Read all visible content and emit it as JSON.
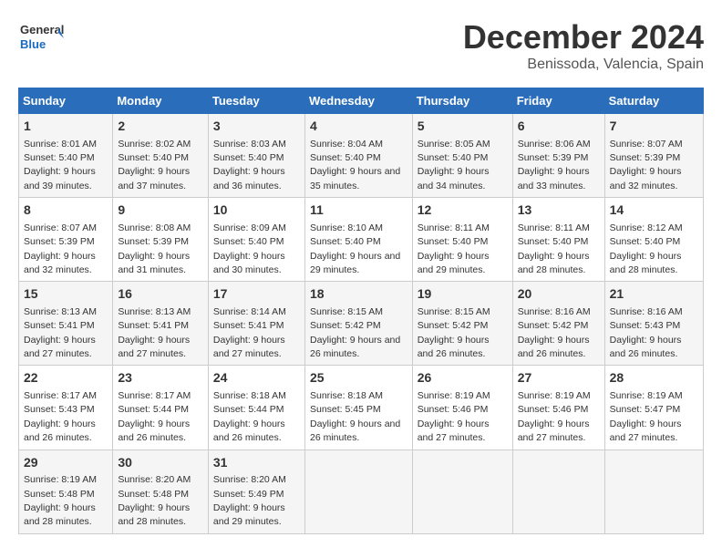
{
  "logo": {
    "line1": "General",
    "line2": "Blue"
  },
  "title": "December 2024",
  "subtitle": "Benissoda, Valencia, Spain",
  "days_of_week": [
    "Sunday",
    "Monday",
    "Tuesday",
    "Wednesday",
    "Thursday",
    "Friday",
    "Saturday"
  ],
  "weeks": [
    [
      {
        "day": "1",
        "sunrise": "8:01 AM",
        "sunset": "5:40 PM",
        "daylight": "9 hours and 39 minutes."
      },
      {
        "day": "2",
        "sunrise": "8:02 AM",
        "sunset": "5:40 PM",
        "daylight": "9 hours and 37 minutes."
      },
      {
        "day": "3",
        "sunrise": "8:03 AM",
        "sunset": "5:40 PM",
        "daylight": "9 hours and 36 minutes."
      },
      {
        "day": "4",
        "sunrise": "8:04 AM",
        "sunset": "5:40 PM",
        "daylight": "9 hours and 35 minutes."
      },
      {
        "day": "5",
        "sunrise": "8:05 AM",
        "sunset": "5:40 PM",
        "daylight": "9 hours and 34 minutes."
      },
      {
        "day": "6",
        "sunrise": "8:06 AM",
        "sunset": "5:39 PM",
        "daylight": "9 hours and 33 minutes."
      },
      {
        "day": "7",
        "sunrise": "8:07 AM",
        "sunset": "5:39 PM",
        "daylight": "9 hours and 32 minutes."
      }
    ],
    [
      {
        "day": "8",
        "sunrise": "8:07 AM",
        "sunset": "5:39 PM",
        "daylight": "9 hours and 32 minutes."
      },
      {
        "day": "9",
        "sunrise": "8:08 AM",
        "sunset": "5:39 PM",
        "daylight": "9 hours and 31 minutes."
      },
      {
        "day": "10",
        "sunrise": "8:09 AM",
        "sunset": "5:40 PM",
        "daylight": "9 hours and 30 minutes."
      },
      {
        "day": "11",
        "sunrise": "8:10 AM",
        "sunset": "5:40 PM",
        "daylight": "9 hours and 29 minutes."
      },
      {
        "day": "12",
        "sunrise": "8:11 AM",
        "sunset": "5:40 PM",
        "daylight": "9 hours and 29 minutes."
      },
      {
        "day": "13",
        "sunrise": "8:11 AM",
        "sunset": "5:40 PM",
        "daylight": "9 hours and 28 minutes."
      },
      {
        "day": "14",
        "sunrise": "8:12 AM",
        "sunset": "5:40 PM",
        "daylight": "9 hours and 28 minutes."
      }
    ],
    [
      {
        "day": "15",
        "sunrise": "8:13 AM",
        "sunset": "5:41 PM",
        "daylight": "9 hours and 27 minutes."
      },
      {
        "day": "16",
        "sunrise": "8:13 AM",
        "sunset": "5:41 PM",
        "daylight": "9 hours and 27 minutes."
      },
      {
        "day": "17",
        "sunrise": "8:14 AM",
        "sunset": "5:41 PM",
        "daylight": "9 hours and 27 minutes."
      },
      {
        "day": "18",
        "sunrise": "8:15 AM",
        "sunset": "5:42 PM",
        "daylight": "9 hours and 26 minutes."
      },
      {
        "day": "19",
        "sunrise": "8:15 AM",
        "sunset": "5:42 PM",
        "daylight": "9 hours and 26 minutes."
      },
      {
        "day": "20",
        "sunrise": "8:16 AM",
        "sunset": "5:42 PM",
        "daylight": "9 hours and 26 minutes."
      },
      {
        "day": "21",
        "sunrise": "8:16 AM",
        "sunset": "5:43 PM",
        "daylight": "9 hours and 26 minutes."
      }
    ],
    [
      {
        "day": "22",
        "sunrise": "8:17 AM",
        "sunset": "5:43 PM",
        "daylight": "9 hours and 26 minutes."
      },
      {
        "day": "23",
        "sunrise": "8:17 AM",
        "sunset": "5:44 PM",
        "daylight": "9 hours and 26 minutes."
      },
      {
        "day": "24",
        "sunrise": "8:18 AM",
        "sunset": "5:44 PM",
        "daylight": "9 hours and 26 minutes."
      },
      {
        "day": "25",
        "sunrise": "8:18 AM",
        "sunset": "5:45 PM",
        "daylight": "9 hours and 26 minutes."
      },
      {
        "day": "26",
        "sunrise": "8:19 AM",
        "sunset": "5:46 PM",
        "daylight": "9 hours and 27 minutes."
      },
      {
        "day": "27",
        "sunrise": "8:19 AM",
        "sunset": "5:46 PM",
        "daylight": "9 hours and 27 minutes."
      },
      {
        "day": "28",
        "sunrise": "8:19 AM",
        "sunset": "5:47 PM",
        "daylight": "9 hours and 27 minutes."
      }
    ],
    [
      {
        "day": "29",
        "sunrise": "8:19 AM",
        "sunset": "5:48 PM",
        "daylight": "9 hours and 28 minutes."
      },
      {
        "day": "30",
        "sunrise": "8:20 AM",
        "sunset": "5:48 PM",
        "daylight": "9 hours and 28 minutes."
      },
      {
        "day": "31",
        "sunrise": "8:20 AM",
        "sunset": "5:49 PM",
        "daylight": "9 hours and 29 minutes."
      },
      null,
      null,
      null,
      null
    ]
  ]
}
